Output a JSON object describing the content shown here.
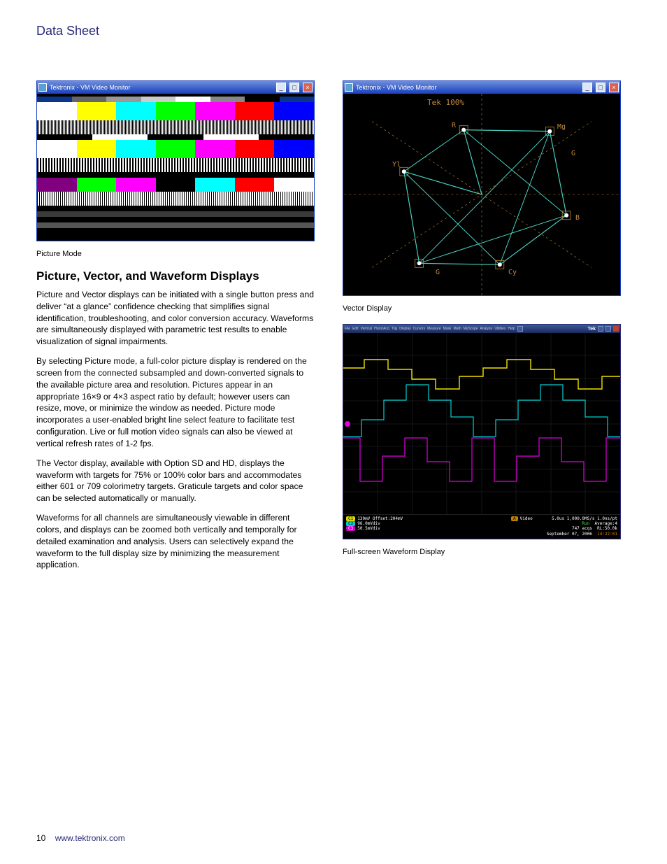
{
  "header": {
    "title": "Data Sheet"
  },
  "left": {
    "fig1": {
      "window_title": "Tektronix - VM Video Monitor",
      "caption": "Picture Mode"
    },
    "section_heading": "Picture, Vector, and Waveform Displays",
    "p1": "Picture and Vector displays can be initiated with a single button press and deliver “at a glance” confidence checking that simplifies signal identification, troubleshooting, and color conversion accuracy. Waveforms are simultaneously displayed with parametric test results to enable visualization of signal impairments.",
    "p2": "By selecting Picture mode, a full-color picture display is rendered on the screen from the connected subsampled and down-converted signals to the available picture area and resolution. Pictures appear in an appropriate 16×9 or 4×3 aspect ratio by default; however users can resize, move, or minimize the window as needed. Picture mode incorporates a user-enabled bright line select feature to facilitate test configuration. Live or full motion video signals can also be viewed at vertical refresh rates of 1-2 fps.",
    "p3": "The Vector display, available with Option SD and HD, displays the waveform with targets for 75% or 100% color bars and accommodates either 601 or 709 colorimetry targets. Graticule targets and color space can be selected automatically or manually.",
    "p4": "Waveforms for all channels are simultaneously viewable in different colors, and displays can be zoomed both vertically and temporally for detailed examination and analysis. Users can selectively expand the waveform to the full display size by minimizing the measurement application."
  },
  "right": {
    "fig2": {
      "window_title": "Tektronix - VM Video Monitor",
      "overlay": "Tek 100%",
      "labels": {
        "R": "R",
        "Mg": "Mg",
        "G": "G",
        "B": "B",
        "Yl": "Yl",
        "Cy": "Cy"
      },
      "caption": "Vector Display"
    },
    "fig3": {
      "menu": [
        "File",
        "Edit",
        "Vertical",
        "Horiz/Acq",
        "Trig",
        "Display",
        "Cursors",
        "Measure",
        "Mask",
        "Math",
        "MyScope",
        "Analyze",
        "Utilities",
        "Help"
      ],
      "brand": "Tek",
      "readout": {
        "ch1": "130mV  Offset:204mV",
        "ch2": "96.0mVdiv",
        "ch3": "50.5mVdiv",
        "vid": "Video",
        "timebase": "5.0us   1,000.0MS/s   1.0ns/pt",
        "acq": "Average:4",
        "samples": "747 acqs",
        "rl": "RL:50.0k",
        "date": "September 07, 2006",
        "time": "14:22:01",
        "run": "Run"
      },
      "caption": "Full-screen Waveform Display"
    }
  },
  "footer": {
    "page": "10",
    "url": "www.tektronix.com"
  }
}
